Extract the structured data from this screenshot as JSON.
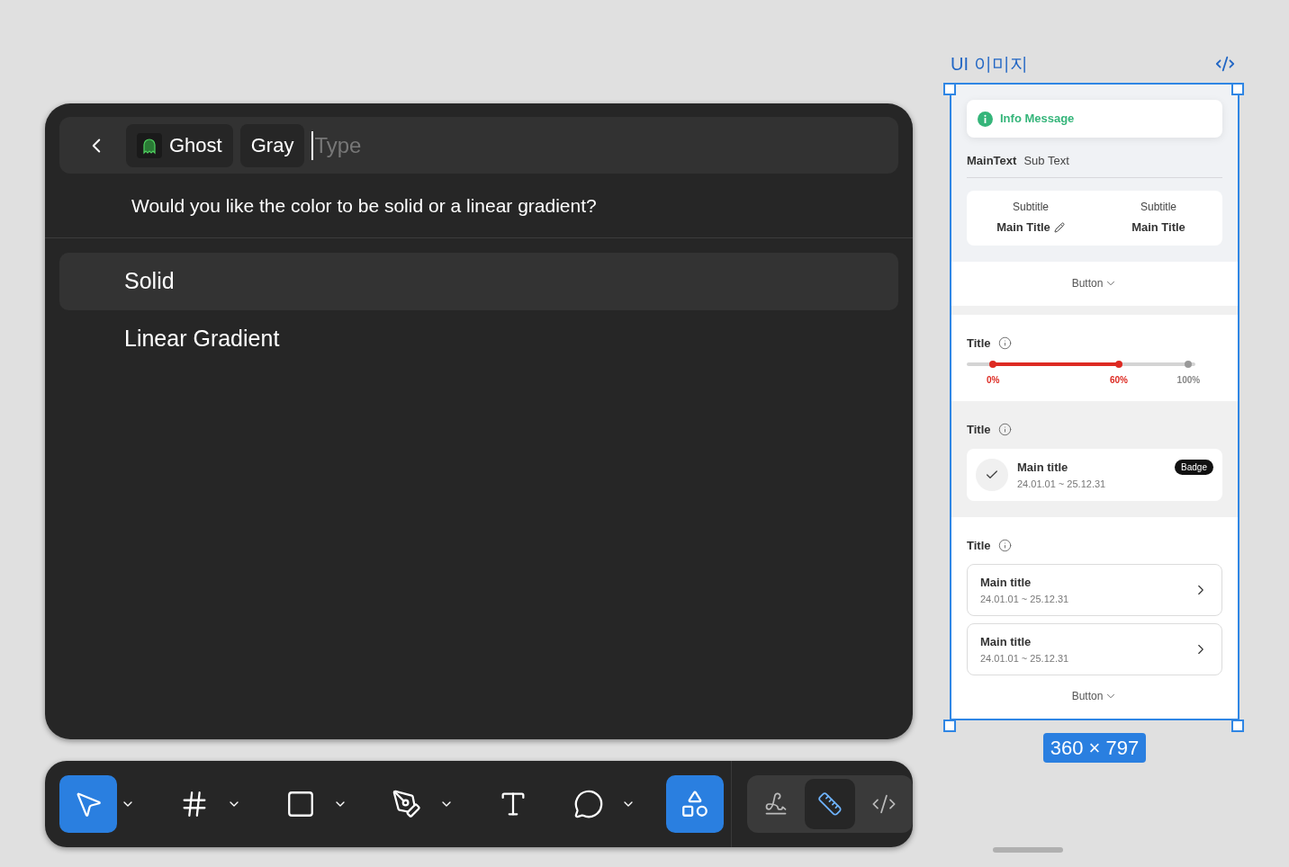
{
  "command_bar": {
    "chips": [
      {
        "kind": "ghost",
        "label": "Ghost"
      },
      {
        "kind": "plain",
        "label": "Gray"
      }
    ],
    "input": {
      "placeholder": "Type"
    },
    "question": "Would you like the color to be solid or a linear gradient?",
    "options": [
      {
        "label": "Solid",
        "selected": true
      },
      {
        "label": "Linear Gradient",
        "selected": false
      }
    ]
  },
  "toolbar": {
    "tools": [
      {
        "kind": "move",
        "selected": true,
        "dropdown": true
      },
      {
        "kind": "frame",
        "selected": false,
        "dropdown": true
      },
      {
        "kind": "rectangle",
        "selected": false,
        "dropdown": true
      },
      {
        "kind": "pen",
        "selected": false,
        "dropdown": true
      },
      {
        "kind": "text",
        "selected": false,
        "dropdown": false
      },
      {
        "kind": "comment",
        "selected": false,
        "dropdown": true
      },
      {
        "kind": "components",
        "selected": true,
        "dropdown": false
      }
    ],
    "modes": [
      {
        "kind": "draw",
        "selected": false
      },
      {
        "kind": "design",
        "selected": true
      },
      {
        "kind": "code",
        "selected": false
      }
    ]
  },
  "frame": {
    "title": "UI 이미지",
    "size": "360 × 797",
    "info_message": "Info Message",
    "main_text": "MainText",
    "sub_text": "Sub Text",
    "stats": [
      {
        "subtitle": "Subtitle",
        "title": "Main Title",
        "editable": true
      },
      {
        "subtitle": "Subtitle",
        "title": "Main Title",
        "editable": false
      }
    ],
    "button_1": "Button",
    "slider_section": {
      "title": "Title",
      "thumbs": [
        {
          "label": "0%",
          "level": 0.115,
          "active": true
        },
        {
          "label": "60%",
          "level": 0.665,
          "active": true
        },
        {
          "label": "100%",
          "level": 0.97,
          "active": false
        }
      ]
    },
    "check_section": {
      "title": "Title",
      "card": {
        "title": "Main title",
        "date": "24.01.01 ~ 25.12.31",
        "badge": "Badge",
        "checked": true
      }
    },
    "list_section": {
      "title": "Title",
      "items": [
        {
          "title": "Main title",
          "date": "24.01.01 ~ 25.12.31"
        },
        {
          "title": "Main title",
          "date": "24.01.01 ~ 25.12.31"
        }
      ]
    },
    "button_2": "Button"
  }
}
